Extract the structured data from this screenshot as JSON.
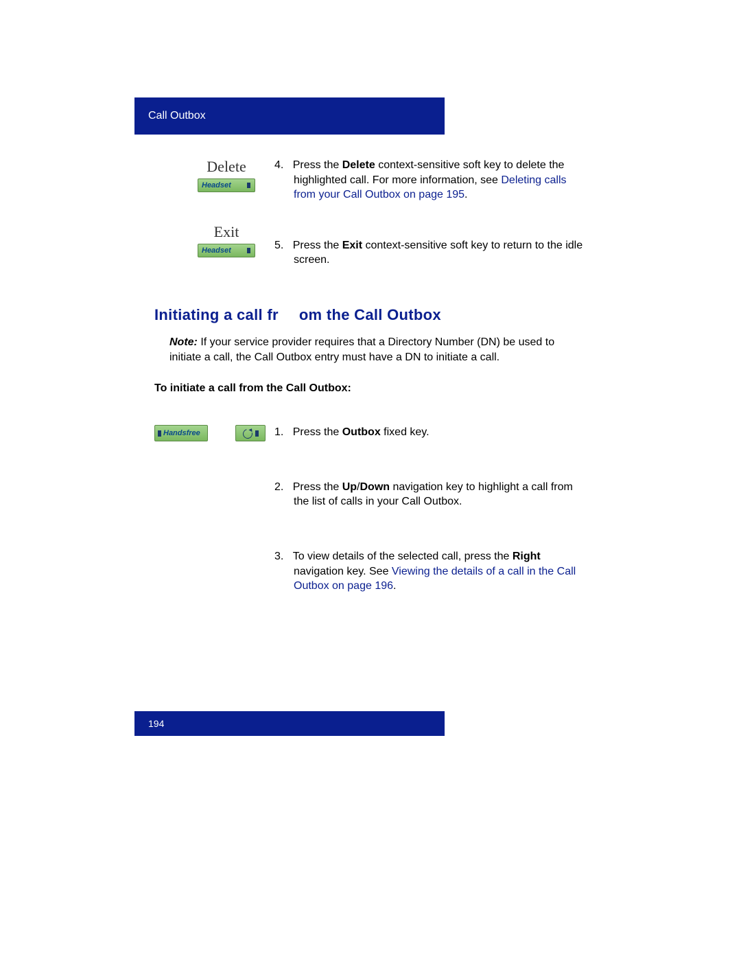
{
  "header": {
    "breadcrumb": "Call Outbox"
  },
  "softkeys": {
    "delete": {
      "label": "Delete",
      "button_text": "Headset"
    },
    "exit": {
      "label": "Exit",
      "button_text": "Headset"
    }
  },
  "steps_top": {
    "s4": {
      "num": "4.",
      "prefix": "Press the ",
      "bold1": "Delete",
      "mid": " context-sensitive soft key to delete the highlighted call. For more information, see  ",
      "link": "Deleting calls from your Call Outbox  on page 195",
      "suffix": "."
    },
    "s5": {
      "num": "5.",
      "prefix": "Press the ",
      "bold1": "Exit",
      "suffix": " context-sensitive soft key to return to the idle screen."
    }
  },
  "section": {
    "heading_a": "Initiating a call fr",
    "heading_b": "om the Call Outbox",
    "note_label": "Note:",
    "note_text": "  If your service provider requires that a Directory Number (DN) be used to initiate a call, the Call Outbox entry must have a DN to initiate a call.",
    "sub_heading": "To initiate a call from the Call Outbox:"
  },
  "handsfree": {
    "button_text": "Handsfree"
  },
  "steps_main": {
    "s1": {
      "num": "1.",
      "prefix": "Press the ",
      "bold1": "Outbox",
      "suffix": " fixed key."
    },
    "s2": {
      "num": "2.",
      "prefix": "Press the ",
      "bold1": "Up",
      "sep": "/",
      "bold2": "Down",
      "suffix": " navigation key to highlight a call from the list of calls in your Call Outbox."
    },
    "s3": {
      "num": "3.",
      "prefix": "To view details of the selected call, press the ",
      "bold1": "Right",
      "mid": " navigation key. See  ",
      "link": "Viewing the details of a call in the Call Outbox  on page 196",
      "suffix": "."
    }
  },
  "footer": {
    "page_number": "194"
  }
}
